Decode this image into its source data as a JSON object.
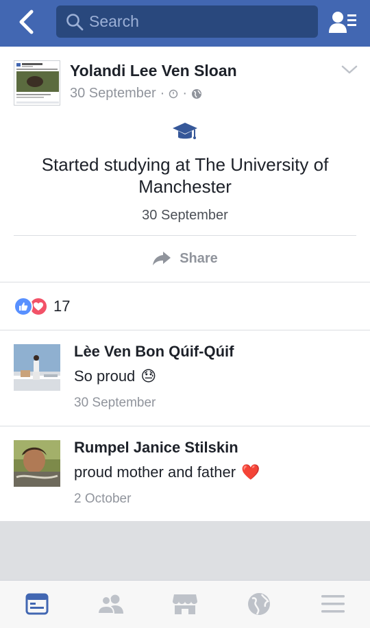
{
  "header": {
    "search_placeholder": "Search",
    "back_icon": "chevron-left-icon",
    "friends_icon": "friend-requests-icon",
    "bar_color": "#4267b2"
  },
  "post": {
    "author": "Yolandi Lee Ven Sloan",
    "date": "30 September",
    "meta_icons": [
      "clock-icon",
      "globe-icon"
    ],
    "milestone_icon": "graduation-cap-icon",
    "milestone_text": "Started studying at The University of Manchester",
    "milestone_date": "30 September",
    "share_label": "Share"
  },
  "reactions": {
    "types": [
      "like",
      "love"
    ],
    "count": "17"
  },
  "comments": [
    {
      "name": "Lèe Ven Bon Qúif-Qúif",
      "text": "So proud",
      "emoji": "😓",
      "date": "30 September"
    },
    {
      "name": "Rumpel Janice Stilskin",
      "text": "proud mother and father",
      "emoji": "❤️",
      "date": "2 October"
    }
  ],
  "bottom_nav": {
    "items": [
      "news-feed-icon",
      "friends-icon",
      "marketplace-icon",
      "notifications-globe-icon",
      "menu-icon"
    ],
    "active_color": "#4267b2",
    "inactive_color": "#bec2c9"
  }
}
